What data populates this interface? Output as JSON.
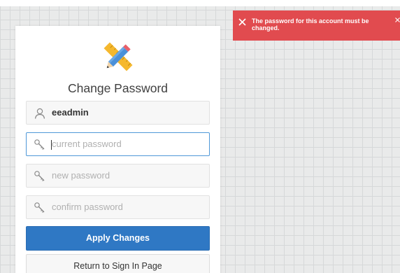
{
  "page": {
    "title": "Change Password",
    "background_color": "#e9eaea"
  },
  "logo": {
    "icon": "pencil-ruler-cross-icon"
  },
  "form": {
    "username": {
      "value": "eeadmin",
      "icon": "user-icon"
    },
    "current_password": {
      "placeholder": "current password",
      "icon": "key-icon",
      "focused": true
    },
    "new_password": {
      "placeholder": "new password",
      "icon": "key-icon"
    },
    "confirm_password": {
      "placeholder": "confirm password",
      "icon": "key-icon"
    }
  },
  "buttons": {
    "apply": "Apply Changes",
    "return": "Return to Sign In Page"
  },
  "alert": {
    "message": "The password for this account must be changed.",
    "icon": "close-icon",
    "color": "#e14b4f"
  },
  "colors": {
    "primary": "#2f78c4",
    "focus_border": "#4f98d8"
  }
}
